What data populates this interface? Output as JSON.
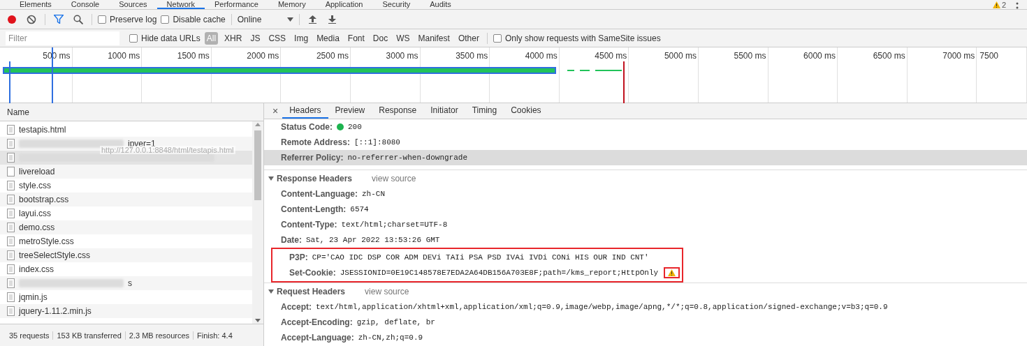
{
  "panel_tabs": [
    {
      "label": "Elements",
      "selected": false
    },
    {
      "label": "Console",
      "selected": false
    },
    {
      "label": "Sources",
      "selected": false
    },
    {
      "label": "Network",
      "selected": true
    },
    {
      "label": "Performance",
      "selected": false
    },
    {
      "label": "Memory",
      "selected": false
    },
    {
      "label": "Application",
      "selected": false
    },
    {
      "label": "Security",
      "selected": false
    },
    {
      "label": "Audits",
      "selected": false
    }
  ],
  "issues_count": "2",
  "toolbar": {
    "recording": true,
    "preserve_log": {
      "label": "Preserve log",
      "checked": false
    },
    "disable_cache": {
      "label": "Disable cache",
      "checked": false
    },
    "throttling": "Online"
  },
  "filter_bar": {
    "placeholder": "Filter",
    "hide_data_urls": {
      "label": "Hide data URLs",
      "checked": false
    },
    "types": [
      {
        "label": "All",
        "selected": true
      },
      {
        "label": "XHR",
        "selected": false
      },
      {
        "label": "JS",
        "selected": false
      },
      {
        "label": "CSS",
        "selected": false
      },
      {
        "label": "Img",
        "selected": false
      },
      {
        "label": "Media",
        "selected": false
      },
      {
        "label": "Font",
        "selected": false
      },
      {
        "label": "Doc",
        "selected": false
      },
      {
        "label": "WS",
        "selected": false
      },
      {
        "label": "Manifest",
        "selected": false
      },
      {
        "label": "Other",
        "selected": false
      }
    ],
    "samesite": {
      "label": "Only show requests with SameSite issues",
      "checked": false
    }
  },
  "timeline": {
    "ticks": [
      "500 ms",
      "1000 ms",
      "1500 ms",
      "2000 ms",
      "2500 ms",
      "3000 ms",
      "3500 ms",
      "4000 ms",
      "4500 ms",
      "5000 ms",
      "5500 ms",
      "6000 ms",
      "6500 ms",
      "7000 ms",
      "7500"
    ]
  },
  "requests": {
    "column": "Name",
    "rows": [
      {
        "kind": "document",
        "name": "testapis.html",
        "redacted": false,
        "highlighted": false
      },
      {
        "kind": "document",
        "name": "ipver=1",
        "redacted": true,
        "highlighted": false
      },
      {
        "kind": "document",
        "redacted": true,
        "highlighted": true
      },
      {
        "kind": "blank",
        "name": "livereload",
        "redacted": false,
        "highlighted": false
      },
      {
        "kind": "document",
        "name": "style.css",
        "redacted": false,
        "highlighted": false
      },
      {
        "kind": "document",
        "name": "bootstrap.css",
        "redacted": false,
        "highlighted": false
      },
      {
        "kind": "document",
        "name": "layui.css",
        "redacted": false,
        "highlighted": false
      },
      {
        "kind": "document",
        "name": "demo.css",
        "redacted": false,
        "highlighted": false
      },
      {
        "kind": "document",
        "name": "metroStyle.css",
        "redacted": false,
        "highlighted": false
      },
      {
        "kind": "document",
        "name": "treeSelectStyle.css",
        "redacted": false,
        "highlighted": false
      },
      {
        "kind": "document",
        "name": "index.css",
        "redacted": false,
        "highlighted": false
      },
      {
        "kind": "document",
        "name": "s",
        "redacted": true,
        "highlighted": false
      },
      {
        "kind": "document",
        "name": "jqmin.js",
        "redacted": false,
        "highlighted": false
      },
      {
        "kind": "document",
        "name": "jquery-1.11.2.min.js",
        "redacted": false,
        "highlighted": false
      }
    ],
    "tooltip": "http://127.0.0.1:8848/html/testapis.html",
    "status_bar": [
      "35 requests",
      "153 KB transferred",
      "2.3 MB resources",
      "Finish: 4.4"
    ]
  },
  "detail_close": "×",
  "detail_tabs": [
    {
      "label": "Headers",
      "selected": true
    },
    {
      "label": "Preview",
      "selected": false
    },
    {
      "label": "Response",
      "selected": false
    },
    {
      "label": "Initiator",
      "selected": false
    },
    {
      "label": "Timing",
      "selected": false
    },
    {
      "label": "Cookies",
      "selected": false
    }
  ],
  "general": [
    {
      "kind": "status",
      "name": "Status Code:",
      "value": "200",
      "highlighted": false
    },
    {
      "kind": "plain",
      "name": "Remote Address:",
      "value": "[::1]:8080",
      "highlighted": false
    },
    {
      "kind": "plain",
      "name": "Referrer Policy:",
      "value": "no-referrer-when-downgrade",
      "highlighted": true
    }
  ],
  "response_headers": {
    "title": "Response Headers",
    "view_source": "view source",
    "expanded": true,
    "headers": [
      {
        "name": "Content-Language:",
        "value": "zh-CN",
        "boxed": false,
        "warning": false
      },
      {
        "name": "Content-Length:",
        "value": "6574",
        "boxed": false,
        "warning": false
      },
      {
        "name": "Content-Type:",
        "value": "text/html;charset=UTF-8",
        "boxed": false,
        "warning": false
      },
      {
        "name": "Date:",
        "value": "Sat, 23 Apr 2022 13:53:26 GMT",
        "boxed": false,
        "warning": false
      },
      {
        "name": "P3P:",
        "value": "CP='CAO IDC DSP COR ADM DEVi TAIi PSA PSD IVAi IVDi CONi HIS OUR IND CNT'",
        "boxed": true,
        "warning": false
      },
      {
        "name": "Set-Cookie:",
        "value": "JSESSIONID=0E19C148578E7EDA2A64DB156A703E8F;path=/kms_report;HttpOnly",
        "boxed": true,
        "warning": true
      }
    ]
  },
  "request_headers": {
    "title": "Request Headers",
    "view_source": "view source",
    "expanded": true,
    "headers": [
      {
        "name": "Accept:",
        "value": "text/html,application/xhtml+xml,application/xml;q=0.9,image/webp,image/apng,*/*;q=0.8,application/signed-exchange;v=b3;q=0.9",
        "boxed": false,
        "warning": false
      },
      {
        "name": "Accept-Encoding:",
        "value": "gzip, deflate, br",
        "boxed": false,
        "warning": false
      },
      {
        "name": "Accept-Language:",
        "value": "zh-CN,zh;q=0.9",
        "boxed": false,
        "warning": false
      }
    ]
  }
}
